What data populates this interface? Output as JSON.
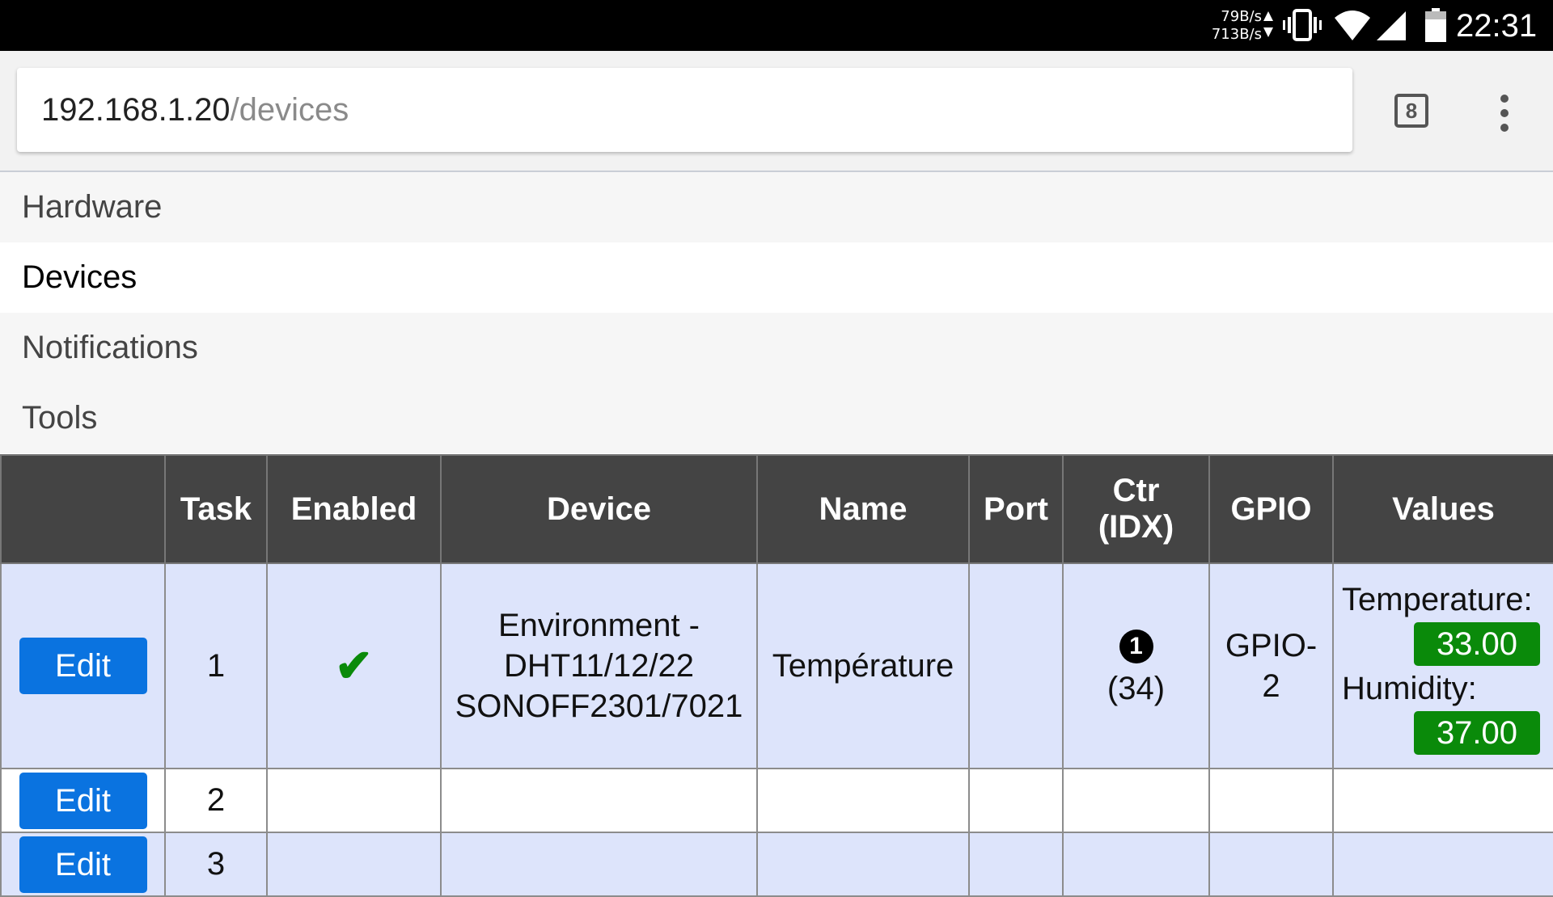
{
  "status_bar": {
    "net_up": "79B/s",
    "net_down": "713B/s",
    "time": "22:31",
    "icons": [
      "vibrate-icon",
      "wifi-icon",
      "signal-icon",
      "battery-icon"
    ]
  },
  "browser": {
    "url_host": "192.168.1.20",
    "url_path": "/devices",
    "tab_count": "8"
  },
  "nav": {
    "items": [
      {
        "label": "Hardware",
        "active": false
      },
      {
        "label": "Devices",
        "active": true
      },
      {
        "label": "Notifications",
        "active": false
      },
      {
        "label": "Tools",
        "active": false
      }
    ]
  },
  "table": {
    "headers": [
      "",
      "Task",
      "Enabled",
      "Device",
      "Name",
      "Port",
      "Ctr (IDX)",
      "GPIO",
      "Values"
    ],
    "header_ctr_line1": "Ctr",
    "header_ctr_line2": "(IDX)",
    "rows": [
      {
        "edit_label": "Edit",
        "task": "1",
        "enabled": "✔",
        "device_line1": "Environment -",
        "device_line2": "DHT11/12/22",
        "device_line3": "SONOFF2301/7021",
        "name": "Température",
        "port": "",
        "ctr": "1",
        "idx": "(34)",
        "gpio_line1": "GPIO-",
        "gpio_line2": "2",
        "values": [
          {
            "label": "Temperature:",
            "value": "33.00"
          },
          {
            "label": "Humidity:",
            "value": "37.00"
          }
        ]
      },
      {
        "edit_label": "Edit",
        "task": "2"
      },
      {
        "edit_label": "Edit",
        "task": "3"
      }
    ]
  },
  "colors": {
    "edit_button": "#0a73e0",
    "value_badge": "#0a8a0a",
    "header_bg": "#444444",
    "row_highlight": "#dde4fb"
  }
}
